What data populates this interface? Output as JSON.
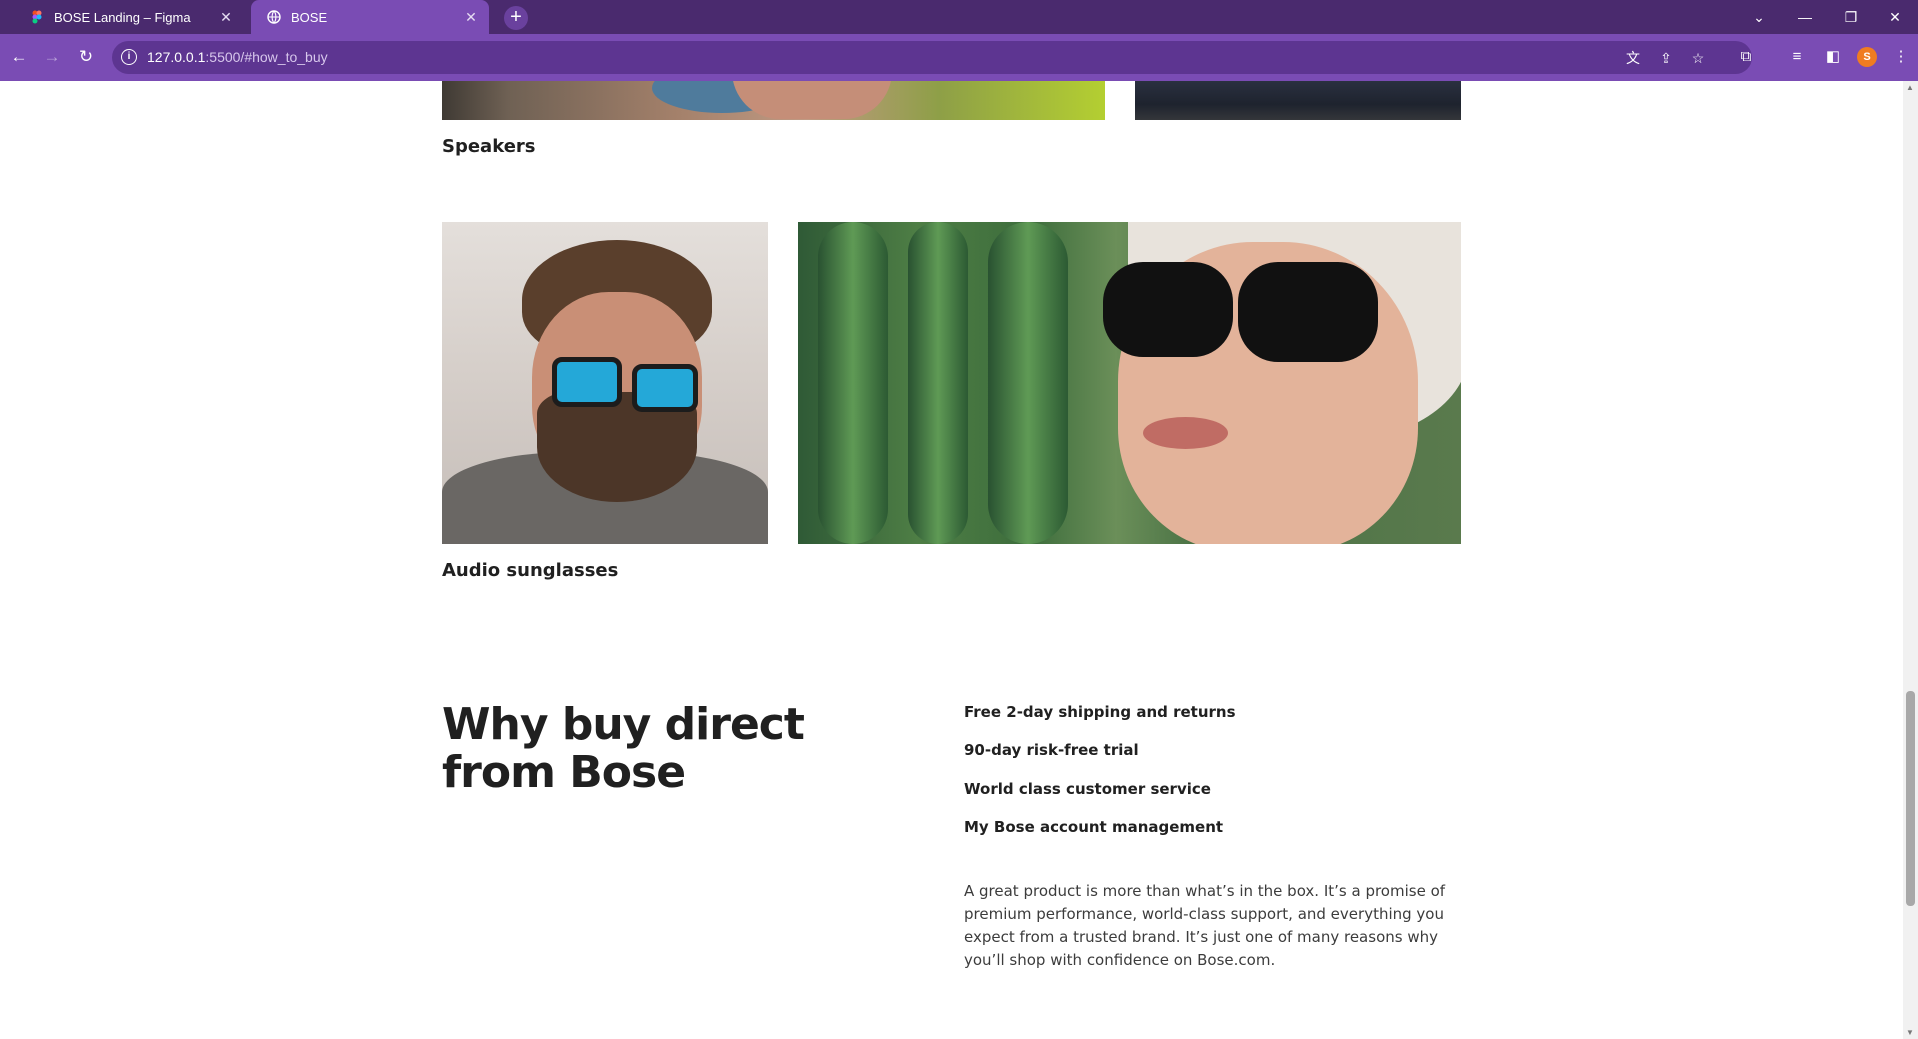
{
  "browser": {
    "tabs": [
      {
        "title": "BOSE Landing – Figma",
        "active": false,
        "favicon": "figma-icon"
      },
      {
        "title": "BOSE",
        "active": true,
        "favicon": "globe-icon"
      }
    ],
    "new_tab_icon": "+",
    "url_host": "127.0.0.1",
    "url_path": ":5500/#how_to_buy",
    "profile_initial": "S",
    "accent_color": "#7a4cb4",
    "tab_strip_color": "#4a2a6e"
  },
  "page": {
    "categories": [
      {
        "label": "Speakers"
      },
      {
        "label": "Audio sunglasses"
      }
    ],
    "why_buy": {
      "title": "Why buy direct from Bose",
      "benefits": [
        "Free 2-day shipping and returns",
        "90-day risk-free trial",
        "World class customer service",
        "My Bose account management"
      ],
      "description": "A great product is more than what’s in the box. It’s a promise of premium performance, world-class support, and everything you expect from a trusted brand. It’s just one of many reasons why you’ll shop with confidence on Bose.com."
    }
  }
}
